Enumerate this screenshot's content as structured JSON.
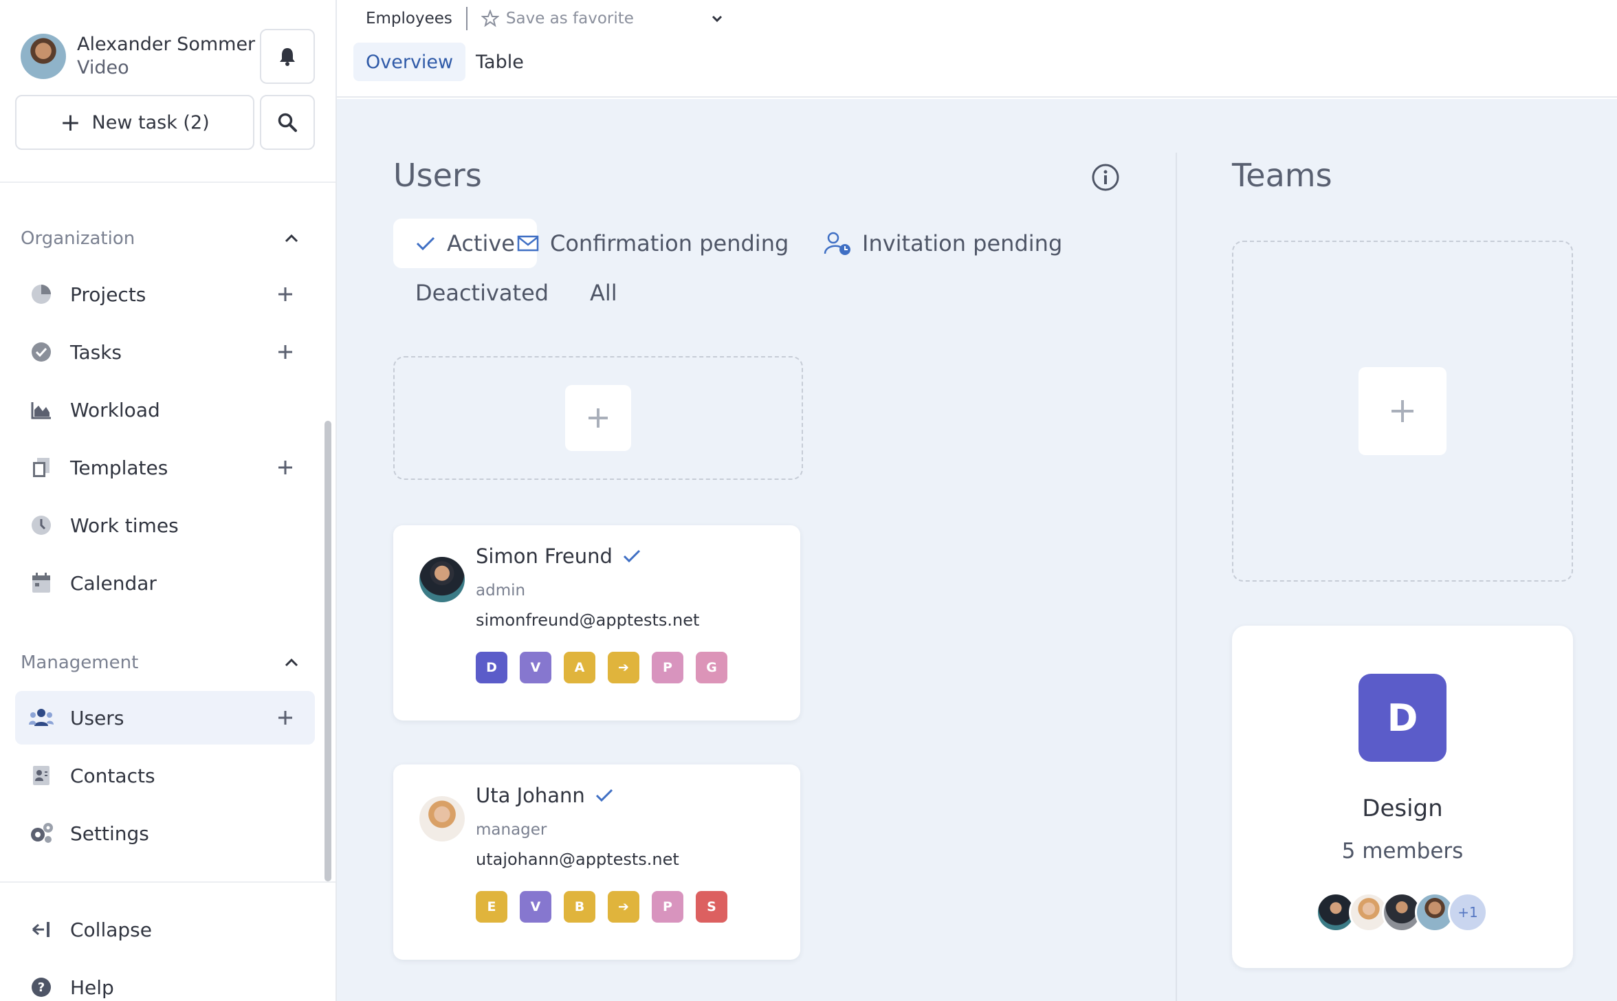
{
  "sidebar": {
    "user": {
      "name": "Alexander Sommer",
      "role": "Video"
    },
    "new_task_label": "New task (2)",
    "sections": {
      "organization": "Organization",
      "management": "Management"
    },
    "org_items": [
      {
        "label": "Projects",
        "icon": "pie-chart-icon"
      },
      {
        "label": "Tasks",
        "icon": "check-circle-icon"
      },
      {
        "label": "Workload",
        "icon": "area-chart-icon"
      },
      {
        "label": "Templates",
        "icon": "copy-icon"
      },
      {
        "label": "Work times",
        "icon": "clock-icon"
      },
      {
        "label": "Calendar",
        "icon": "calendar-icon"
      }
    ],
    "mgmt_items": [
      {
        "label": "Users",
        "icon": "users-icon"
      },
      {
        "label": "Contacts",
        "icon": "contact-card-icon"
      },
      {
        "label": "Settings",
        "icon": "gears-icon"
      }
    ],
    "footer": {
      "collapse": "Collapse",
      "help": "Help"
    }
  },
  "topbar": {
    "breadcrumb": "Employees",
    "favorite_label": "Save as favorite",
    "tabs": [
      "Overview",
      "Table"
    ]
  },
  "users": {
    "title": "Users",
    "filters": [
      "Active",
      "Confirmation pending",
      "Invitation pending",
      "Deactivated",
      "All"
    ],
    "cards": [
      {
        "name": "Simon Freund",
        "role": "admin",
        "email": "simonfreund@apptests.net",
        "badges": [
          {
            "letter": "D",
            "color": "#5b5cc9"
          },
          {
            "letter": "V",
            "color": "#8677cf"
          },
          {
            "letter": "A",
            "color": "#e0b43c"
          },
          {
            "letter": "➔",
            "color": "#e0b43c"
          },
          {
            "letter": "P",
            "color": "#d894be"
          },
          {
            "letter": "G",
            "color": "#dc94b8"
          }
        ]
      },
      {
        "name": "Uta Johann",
        "role": "manager",
        "email": "utajohann@apptests.net",
        "badges": [
          {
            "letter": "E",
            "color": "#e0b43c"
          },
          {
            "letter": "V",
            "color": "#8677cf"
          },
          {
            "letter": "B",
            "color": "#e0b43c"
          },
          {
            "letter": "➔",
            "color": "#e0b43c"
          },
          {
            "letter": "P",
            "color": "#d894be"
          },
          {
            "letter": "S",
            "color": "#dc6060"
          }
        ]
      }
    ]
  },
  "teams": {
    "title": "Teams",
    "cards": [
      {
        "logo_letter": "D",
        "name": "Design",
        "members": "5 members",
        "overflow": "+1"
      }
    ]
  },
  "colors": {
    "accent": "#2f5aa8",
    "background": "#edf2f9",
    "team_logo": "#5b5cc9"
  }
}
